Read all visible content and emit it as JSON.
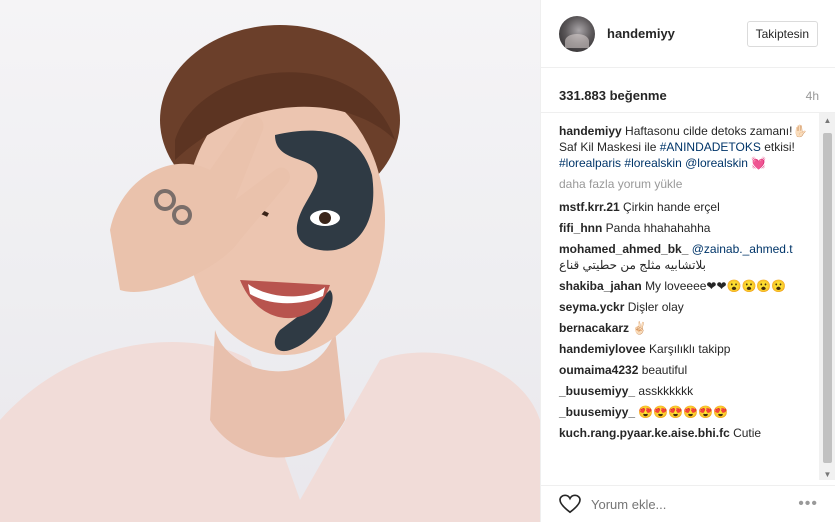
{
  "post": {
    "photo_alt": "",
    "author": {
      "username": "handemiyy",
      "follow_label": "Takiptesin"
    },
    "likes_text": "331.883 beğenme",
    "time_ago": "4h",
    "caption": {
      "username": "handemiyy",
      "text_1": "Haftasonu cilde detoks zamanı!",
      "text_2": "Saf Kil Maskesi ile",
      "hashtag_1": "#ANINDADETOKS",
      "text_3": "etkisi!",
      "hashtag_2": "#lorealparis",
      "hashtag_3": "#lorealskin",
      "mention": "@lorealskin",
      "emoji": "💓"
    },
    "load_more_label": "daha fazla yorum yükle",
    "comments": [
      {
        "username": "mstf.krr.21",
        "text": "Çirkin hande erçel"
      },
      {
        "username": "fifi_hnn",
        "text": "Panda hhahahahha"
      },
      {
        "username": "mohamed_ahmed_bk_",
        "mention": "@zainab._ahmed.t",
        "text": "بلاتشابيه مثلج من حطيتي قناع"
      },
      {
        "username": "shakiba_jahan",
        "text": "My loveeee❤❤😮😮😮😮"
      },
      {
        "username": "seyma.yckr",
        "text": "Dişler olay"
      },
      {
        "username": "bernacakarz",
        "text": "✌🏻"
      },
      {
        "username": "handemiylovee",
        "text": "Karşılıklı takipp"
      },
      {
        "username": "oumaima4232",
        "text": "beautiful"
      },
      {
        "username": "_buusemiyy_",
        "text": "asskkkkkk"
      },
      {
        "username": "_buusemiyy_",
        "text": "😍😍😍😍😍😍"
      },
      {
        "username": "kuch.rang.pyaar.ke.aise.bhi.fc",
        "text": "Cutie"
      }
    ],
    "add_comment_placeholder": "Yorum ekle...",
    "more_options": "•••"
  },
  "icons": {
    "heart": "heart-outline-icon",
    "more": "more-options-icon"
  },
  "colors": {
    "link": "#003569",
    "border": "#efefef",
    "muted": "#999999"
  }
}
